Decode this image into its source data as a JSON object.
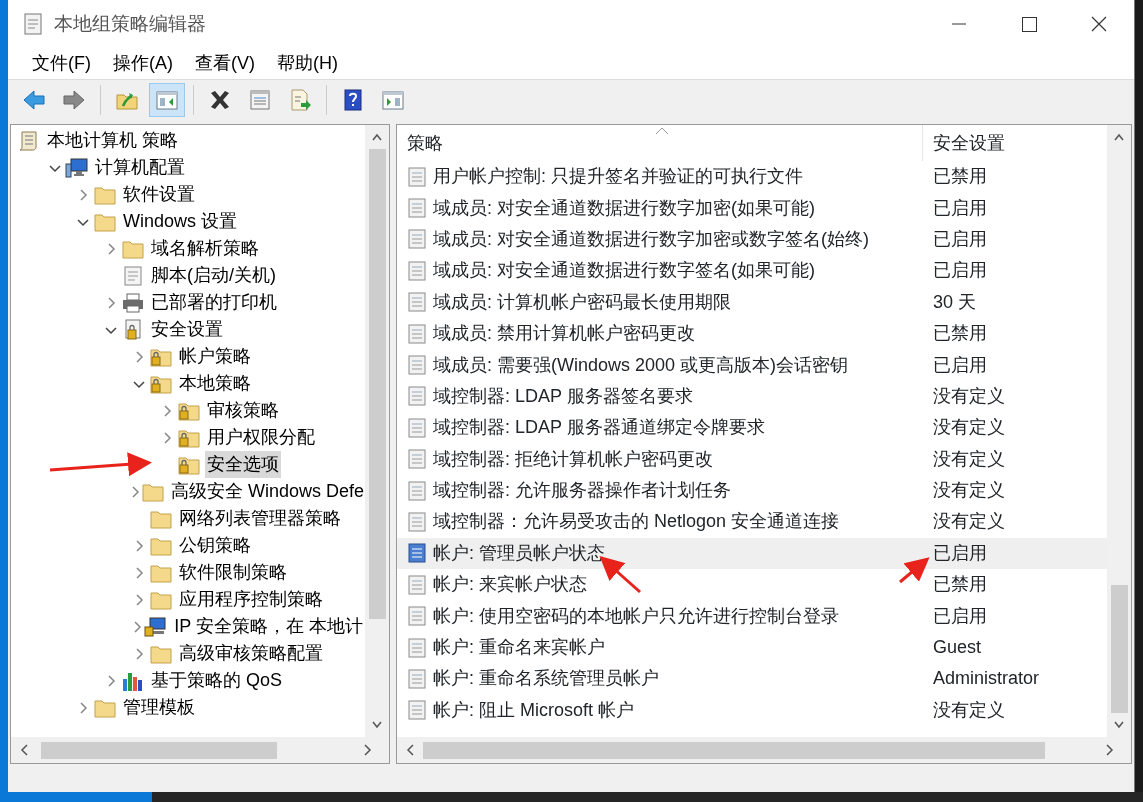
{
  "window": {
    "title": "本地组策略编辑器"
  },
  "menu": [
    "文件(F)",
    "操作(A)",
    "查看(V)",
    "帮助(H)"
  ],
  "toolbar": [
    {
      "kind": "back",
      "pressed": false
    },
    {
      "kind": "forward",
      "pressed": false
    },
    {
      "kind": "sep"
    },
    {
      "kind": "up",
      "pressed": false
    },
    {
      "kind": "tree",
      "pressed": true
    },
    {
      "kind": "sep"
    },
    {
      "kind": "delete",
      "pressed": false
    },
    {
      "kind": "properties",
      "pressed": false
    },
    {
      "kind": "export",
      "pressed": false
    },
    {
      "kind": "sep"
    },
    {
      "kind": "help",
      "pressed": false
    },
    {
      "kind": "actionpane",
      "pressed": false
    }
  ],
  "tree": [
    {
      "label": "本地计算机 策略",
      "kind": "scroll",
      "selected": false,
      "children": [
        {
          "label": "计算机配置",
          "kind": "computer",
          "expanded": true,
          "selected": false,
          "children": [
            {
              "label": "软件设置",
              "kind": "folder",
              "expanded": false,
              "selected": false
            },
            {
              "label": "Windows 设置",
              "kind": "folder",
              "expanded": true,
              "selected": false,
              "children": [
                {
                  "label": "域名解析策略",
                  "kind": "folder",
                  "expanded": false,
                  "selected": false
                },
                {
                  "label": "脚本(启动/关机)",
                  "kind": "script",
                  "selected": false
                },
                {
                  "label": "已部署的打印机",
                  "kind": "printer",
                  "expanded": false,
                  "selected": false
                },
                {
                  "label": "安全设置",
                  "kind": "secure",
                  "expanded": true,
                  "selected": false,
                  "children": [
                    {
                      "label": "帐户策略",
                      "kind": "lockfolder",
                      "expanded": false,
                      "selected": false
                    },
                    {
                      "label": "本地策略",
                      "kind": "lockfolder",
                      "expanded": true,
                      "selected": false,
                      "children": [
                        {
                          "label": "审核策略",
                          "kind": "lockfolder",
                          "expanded": false,
                          "selected": false
                        },
                        {
                          "label": "用户权限分配",
                          "kind": "lockfolder",
                          "expanded": false,
                          "selected": false
                        },
                        {
                          "label": "安全选项",
                          "kind": "lockfolder",
                          "selected": true
                        }
                      ]
                    },
                    {
                      "label": "高级安全 Windows Defe",
                      "kind": "folder",
                      "expanded": false,
                      "selected": false
                    },
                    {
                      "label": "网络列表管理器策略",
                      "kind": "folder",
                      "selected": false
                    },
                    {
                      "label": "公钥策略",
                      "kind": "folder",
                      "expanded": false,
                      "selected": false
                    },
                    {
                      "label": "软件限制策略",
                      "kind": "folder",
                      "expanded": false,
                      "selected": false
                    },
                    {
                      "label": "应用程序控制策略",
                      "kind": "folder",
                      "expanded": false,
                      "selected": false
                    },
                    {
                      "label": "IP 安全策略，在 本地计",
                      "kind": "ip",
                      "expanded": false,
                      "selected": false
                    },
                    {
                      "label": "高级审核策略配置",
                      "kind": "folder",
                      "expanded": false,
                      "selected": false
                    }
                  ]
                },
                {
                  "label": "基于策略的 QoS",
                  "kind": "chart",
                  "expanded": false,
                  "selected": false
                }
              ]
            },
            {
              "label": "管理模板",
              "kind": "folder",
              "expanded": false,
              "selected": false
            }
          ]
        }
      ]
    }
  ],
  "table": {
    "columns": [
      "策略",
      "安全设置"
    ],
    "rows": [
      {
        "policy": "用户帐户控制: 只提升签名并验证的可执行文件",
        "setting": "已禁用",
        "selected": false
      },
      {
        "policy": "域成员: 对安全通道数据进行数字加密(如果可能)",
        "setting": "已启用",
        "selected": false
      },
      {
        "policy": "域成员: 对安全通道数据进行数字加密或数字签名(始终)",
        "setting": "已启用",
        "selected": false
      },
      {
        "policy": "域成员: 对安全通道数据进行数字签名(如果可能)",
        "setting": "已启用",
        "selected": false
      },
      {
        "policy": "域成员: 计算机帐户密码最长使用期限",
        "setting": "30 天",
        "selected": false
      },
      {
        "policy": "域成员: 禁用计算机帐户密码更改",
        "setting": "已禁用",
        "selected": false
      },
      {
        "policy": "域成员: 需要强(Windows 2000 或更高版本)会话密钥",
        "setting": "已启用",
        "selected": false
      },
      {
        "policy": "域控制器: LDAP 服务器签名要求",
        "setting": "没有定义",
        "selected": false
      },
      {
        "policy": "域控制器: LDAP 服务器通道绑定令牌要求",
        "setting": "没有定义",
        "selected": false
      },
      {
        "policy": "域控制器: 拒绝计算机帐户密码更改",
        "setting": "没有定义",
        "selected": false
      },
      {
        "policy": "域控制器: 允许服务器操作者计划任务",
        "setting": "没有定义",
        "selected": false
      },
      {
        "policy": "域控制器：允许易受攻击的 Netlogon 安全通道连接",
        "setting": "没有定义",
        "selected": false
      },
      {
        "policy": "帐户: 管理员帐户状态",
        "setting": "已启用",
        "selected": true
      },
      {
        "policy": "帐户: 来宾帐户状态",
        "setting": "已禁用",
        "selected": false
      },
      {
        "policy": "帐户: 使用空密码的本地帐户只允许进行控制台登录",
        "setting": "已启用",
        "selected": false
      },
      {
        "policy": "帐户: 重命名来宾帐户",
        "setting": "Guest",
        "selected": false
      },
      {
        "policy": "帐户: 重命名系统管理员帐户",
        "setting": "Administrator",
        "selected": false
      },
      {
        "policy": "帐户: 阻止 Microsoft 帐户",
        "setting": "没有定义",
        "selected": false
      }
    ]
  }
}
